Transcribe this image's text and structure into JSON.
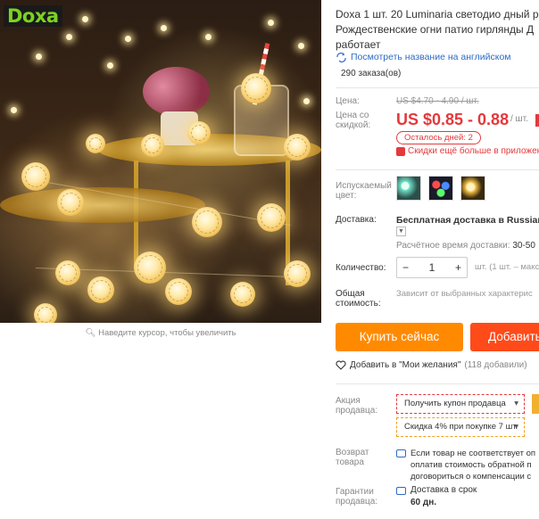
{
  "image": {
    "brand": "Doxa",
    "zoom_hint": "Наведите курсор, чтобы увеличить"
  },
  "product": {
    "title_line1": "Doxa 1 шт. 20 Luminaria светодио дный р",
    "title_line2": "Рождественские огни патио гирлянды Д",
    "title_line3": "работает",
    "translate_link": "Посмотреть название на английском",
    "orders": "290 заказа(ов)"
  },
  "pricing": {
    "price_label": "Цена:",
    "old_price": "US $4.70 - 4.90 / шт.",
    "discount_label_1": "Цена со",
    "discount_label_2": "скидкой:",
    "price": "US $0.85 - 0.88",
    "per_unit": "/ шт.",
    "days_left": "Осталось дней: 2",
    "more_discounts": "Скидки ещё больше в приложен"
  },
  "options": {
    "color_label_1": "Испускаемый",
    "color_label_2": "цвет:",
    "shipping_label": "Доставка:",
    "shipping_value": "Бесплатная доставка в Russian Fe",
    "est_label": "Расчётное время доставки:",
    "est_value": "30-50",
    "qty_label": "Количество:",
    "qty_value": "1",
    "qty_minus": "−",
    "qty_plus": "+",
    "qty_note": "шт. (1 шт. – макс",
    "total_label_1": "Общая",
    "total_label_2": "стоимость:",
    "total_note": "Зависит от выбранных характерис"
  },
  "actions": {
    "buy": "Купить сейчас",
    "cart": "Добавить",
    "wishlist": "Добавить в \"Мои желания\"",
    "wishlist_count": "(118 добавили)"
  },
  "seller": {
    "promo_label_1": "Акция",
    "promo_label_2": "продавца:",
    "coupon": "Получить купон продавца",
    "coupon2": "Скидка 4% при покупке 7 шт.",
    "return_label_1": "Возврат",
    "return_label_2": "товара",
    "return_line1": "Если товар не соответствует оп",
    "return_line2": "оплатив стоимость обратной п",
    "return_line3": "договориться о компенсации с",
    "guarantee_label_1": "Гарантии",
    "guarantee_label_2": "продавца:",
    "guarantee_value": "Доставка в срок",
    "guarantee_days": "60 дн."
  },
  "colors": {
    "accent_red": "#e4393c",
    "buy_orange": "#ff8a00",
    "cart_orange": "#ff4a1a",
    "link_blue": "#2e6bc6",
    "brand_green": "#7bd321"
  }
}
